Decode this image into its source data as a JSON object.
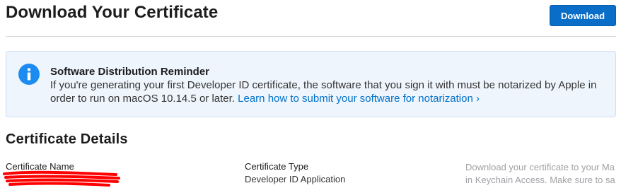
{
  "header": {
    "title": "Download Your Certificate",
    "download_label": "Download"
  },
  "reminder": {
    "icon": "info-icon",
    "title": "Software Distribution Reminder",
    "text": "If you're generating your first Developer ID certificate, the software that you sign it with must be notarized by Apple in order to run on macOS 10.14.5 or later.",
    "link_text": "Learn how to submit your software for notarization ›"
  },
  "details": {
    "section_title": "Certificate Details",
    "name_label": "Certificate Name",
    "type_label": "Certificate Type",
    "type_value": "Developer ID Application",
    "note_line1": "Download your certificate to your Ma",
    "note_line2": "in Keychain Access. Make sure to sa"
  },
  "colors": {
    "accent": "#0a6ec8",
    "link": "#0070c9",
    "info_bg": "#eef5fc",
    "info_icon": "#1d8cf0",
    "redaction": "#ff0000"
  }
}
